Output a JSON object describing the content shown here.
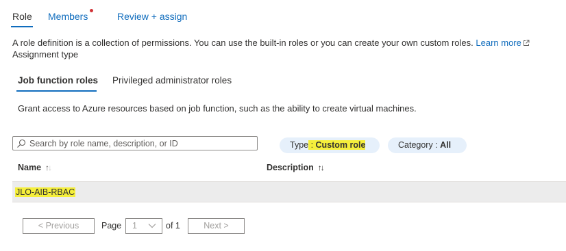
{
  "tabs": [
    {
      "label": "Role"
    },
    {
      "label": "Members"
    },
    {
      "label": "Review + assign"
    }
  ],
  "description": {
    "text": "A role definition is a collection of permissions. You can use the built-in roles or you can create your own custom roles.",
    "learn_more": "Learn more"
  },
  "assignment_type_label": "Assignment type",
  "sub_tabs": [
    {
      "label": "Job function roles"
    },
    {
      "label": "Privileged administrator roles"
    }
  ],
  "job_function_description": "Grant access to Azure resources based on job function, such as the ability to create virtual machines.",
  "search": {
    "placeholder": "Search by role name, description, or ID"
  },
  "filters": {
    "type": {
      "label": "Type",
      "value": "Custom role"
    },
    "category": {
      "label": "Category",
      "value": "All"
    }
  },
  "table": {
    "columns": [
      {
        "label": "Name"
      },
      {
        "label": "Description"
      }
    ],
    "rows": [
      {
        "name": "JLO-AIB-RBAC",
        "description": ""
      }
    ]
  },
  "pagination": {
    "previous": "< Previous",
    "page_label": "Page",
    "page_value": "1",
    "of_label": "of 1",
    "next": "Next >"
  },
  "colors": {
    "accent": "#0f6cbd",
    "highlight": "#f5ef3b",
    "notification_dot": "#d13438",
    "pill_bg": "#e6f0fb"
  }
}
